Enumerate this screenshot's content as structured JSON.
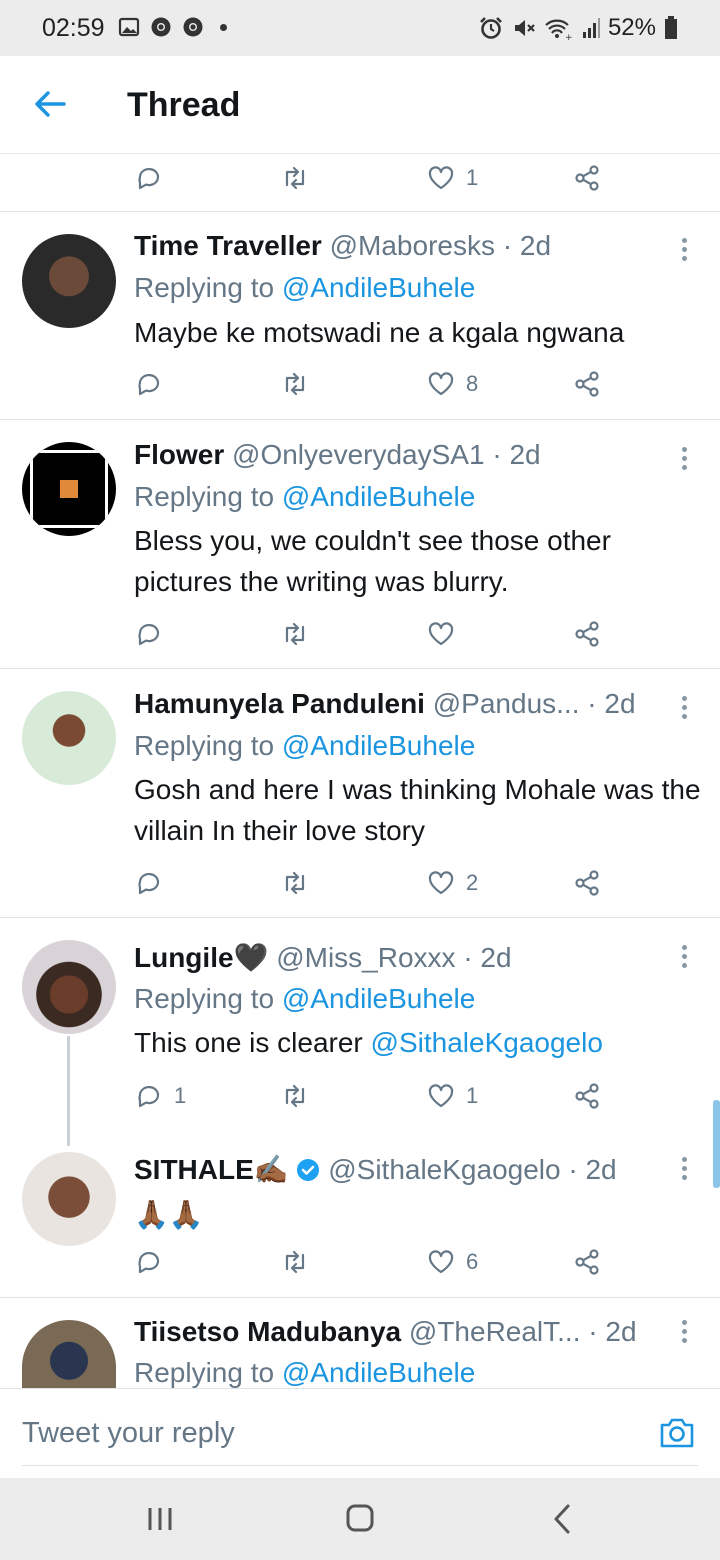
{
  "status_bar": {
    "time": "02:59",
    "battery": "52%"
  },
  "header": {
    "title": "Thread"
  },
  "top_actions": {
    "like_count": "1"
  },
  "tweets": [
    {
      "name": "Time Traveller",
      "handle": "@Maboresks",
      "time": "· 2d",
      "replying_label": "Replying to",
      "replying_to": "@AndileBuhele",
      "text": "Maybe ke motswadi ne a kgala ngwana",
      "reply_count": "",
      "like_count": "8"
    },
    {
      "name": "Flower",
      "handle": "@OnlyeverydaySA1",
      "time": "· 2d",
      "replying_label": "Replying to",
      "replying_to": "@AndileBuhele",
      "text": "Bless you, we couldn't see those other pictures the writing was blurry.",
      "reply_count": "",
      "like_count": ""
    },
    {
      "name": "Hamunyela Panduleni",
      "handle": "@Pandus...",
      "time": "· 2d",
      "replying_label": "Replying to",
      "replying_to": "@AndileBuhele",
      "text": "Gosh and here I was thinking Mohale was the villain In their love story",
      "reply_count": "",
      "like_count": "2"
    },
    {
      "name": "Lungile🖤",
      "handle": "@Miss_Roxxx",
      "time": "· 2d",
      "replying_label": "Replying to",
      "replying_to": "@AndileBuhele",
      "text": "This one is clearer",
      "text_mention": "@SithaleKgaogelo",
      "reply_count": "1",
      "like_count": "1"
    },
    {
      "name": "SITHALE✍🏾",
      "handle": "@SithaleKgaogelo",
      "time": "· 2d",
      "text": "🙏🏾🙏🏾",
      "reply_count": "",
      "like_count": "6"
    },
    {
      "name": "Tiisetso Madubanya",
      "handle": "@TheRealT...",
      "time": "· 2d",
      "replying_label": "Replying to",
      "replying_to": "@AndileBuhele"
    }
  ],
  "reply_box": {
    "placeholder": "Tweet your reply"
  },
  "colors": {
    "accent": "#1b95e0",
    "muted": "#657786"
  }
}
